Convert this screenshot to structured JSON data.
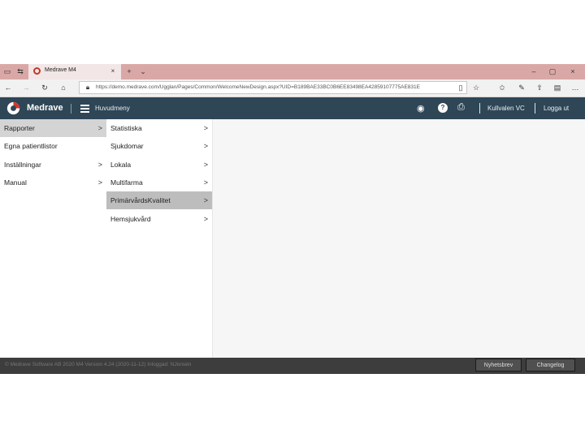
{
  "browser": {
    "tab_title": "Medrave M4",
    "url": "https://demo.medrave.com/Ugglan/Pages/Common/WelcomeNewDesign.aspx?UID=B189BAE33BC0B6EE83498EA42859107775AE831E"
  },
  "header": {
    "brand": "Medrave",
    "menu_label": "Huvudmeny",
    "user": "Kullvalen VC",
    "logout": "Logga ut"
  },
  "menu_left": [
    {
      "label": "Rapporter",
      "chevron": ">"
    },
    {
      "label": "Egna patientlistor",
      "chevron": ""
    },
    {
      "label": "Inställningar",
      "chevron": ">"
    },
    {
      "label": "Manual",
      "chevron": ">"
    }
  ],
  "menu_right": [
    {
      "label": "Statistiska",
      "chevron": ">"
    },
    {
      "label": "Sjukdomar",
      "chevron": ">"
    },
    {
      "label": "Lokala",
      "chevron": ">"
    },
    {
      "label": "Multifarma",
      "chevron": ">"
    },
    {
      "label": "PrimärvårdsKvalitet",
      "chevron": ">"
    },
    {
      "label": "Hemsjukvård",
      "chevron": ">"
    }
  ],
  "footer": {
    "text": "© Medrave Software AB 2020 M4 Version 4.24 (2020-11-12) Inloggad: NJonsén",
    "btn_news": "Nyhetsbrev",
    "btn_changelog": "Changelog"
  },
  "colors": {
    "header_bg": "#2e4656",
    "tab_strip": "#d9a8a6",
    "selected_item": "#d4d4d4"
  }
}
